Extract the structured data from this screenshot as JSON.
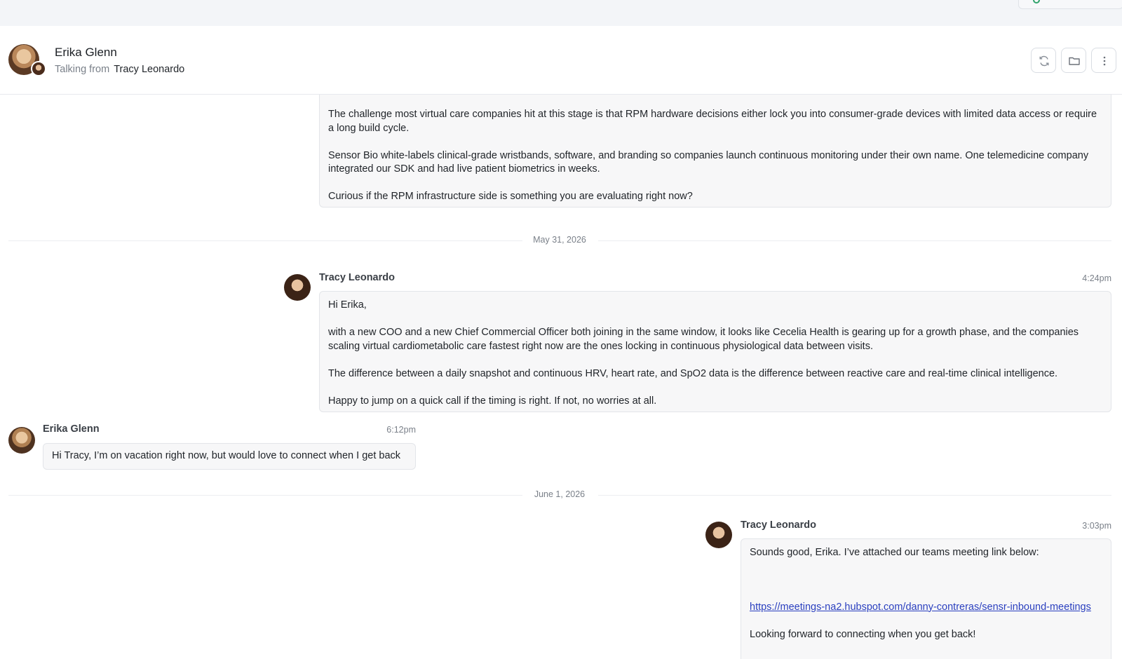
{
  "header": {
    "contact_name": "Erika Glenn",
    "talking_prefix": "Talking from",
    "talking_from": "Tracy Leonardo",
    "actions": [
      {
        "icon": "sync-icon"
      },
      {
        "icon": "folder-icon"
      },
      {
        "icon": "more-vertical-icon"
      }
    ]
  },
  "messages": {
    "m1": {
      "paragraphs": [
        "The challenge most virtual care companies hit at this stage is that RPM hardware decisions either lock you into consumer-grade devices with limited data access or require a long build cycle.",
        "Sensor Bio white-labels clinical-grade wristbands, software, and branding so companies launch continuous monitoring under their own name. One telemedicine company integrated our SDK and had live patient biometrics in weeks.",
        "Curious if the RPM infrastructure side is something you are evaluating right now?"
      ]
    },
    "sep1": "May 31, 2026",
    "m2": {
      "sender": "Tracy Leonardo",
      "time": "4:24pm",
      "paragraphs": [
        "Hi Erika,",
        "with a new COO and a new Chief Commercial Officer both joining in the same window, it looks like Cecelia Health is gearing up for a growth phase, and the companies scaling virtual cardiometabolic care fastest right now are the ones locking in continuous physiological data between visits.",
        "The difference between a daily snapshot and continuous HRV, heart rate, and SpO2 data is the difference between reactive care and real-time clinical intelligence.",
        "Happy to jump on a quick call if the timing is right. If not, no worries at all."
      ]
    },
    "m3": {
      "sender": "Erika Glenn",
      "time": "6:12pm",
      "text": "Hi Tracy, I’m on vacation right now, but would love to connect when I get back"
    },
    "sep2": "June 1, 2026",
    "m4": {
      "sender": "Tracy Leonardo",
      "time": "3:03pm",
      "line1": "Sounds good, Erika. I’ve attached our teams meeting link below:",
      "link": "https://meetings-na2.hubspot.com/danny-contreras/sensr-inbound-meetings",
      "line3": "Looking forward to connecting when you get back!"
    }
  }
}
